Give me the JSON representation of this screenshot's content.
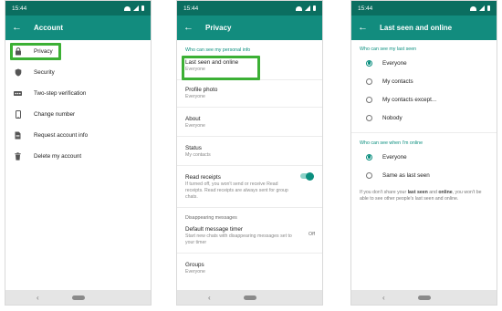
{
  "status_time": "15:44",
  "account": {
    "title": "Account",
    "items": [
      {
        "label": "Privacy",
        "icon": "lock-icon"
      },
      {
        "label": "Security",
        "icon": "shield-icon"
      },
      {
        "label": "Two-step verification",
        "icon": "dots-icon"
      },
      {
        "label": "Change number",
        "icon": "phone-icon"
      },
      {
        "label": "Request account info",
        "icon": "document-icon"
      },
      {
        "label": "Delete my account",
        "icon": "trash-icon"
      }
    ]
  },
  "privacy": {
    "title": "Privacy",
    "section_label": "Who can see my personal info",
    "items": [
      {
        "label": "Last seen and online",
        "value": "Everyone"
      },
      {
        "label": "Profile photo",
        "value": "Everyone"
      },
      {
        "label": "About",
        "value": "Everyone"
      },
      {
        "label": "Status",
        "value": "My contacts"
      }
    ],
    "read_receipts": {
      "label": "Read receipts",
      "description": "If turned off, you won't send or receive Read receipts. Read receipts are always sent for group chats."
    },
    "disappearing_label": "Disappearing messages",
    "default_timer": {
      "label": "Default message timer",
      "description": "Start new chats with disappearing messages set to your timer",
      "value": "Off"
    },
    "groups": {
      "label": "Groups",
      "value": "Everyone"
    }
  },
  "last_seen": {
    "title": "Last seen and online",
    "section1_label": "Who can see my last seen",
    "options1": [
      "Everyone",
      "My contacts",
      "My contacts except...",
      "Nobody"
    ],
    "section2_label": "Who can see when I'm online",
    "options2": [
      "Everyone",
      "Same as last seen"
    ],
    "note_prefix": "If you don't share your ",
    "note_bold1": "last seen",
    "note_and": " and ",
    "note_bold2": "online",
    "note_suffix": ", you won't be able to see other people's last seen and online."
  },
  "colors": {
    "status_bar": "#0b6e60",
    "app_bar": "#128c7e",
    "accent": "#0b8f7f",
    "highlight": "#3cb035"
  }
}
